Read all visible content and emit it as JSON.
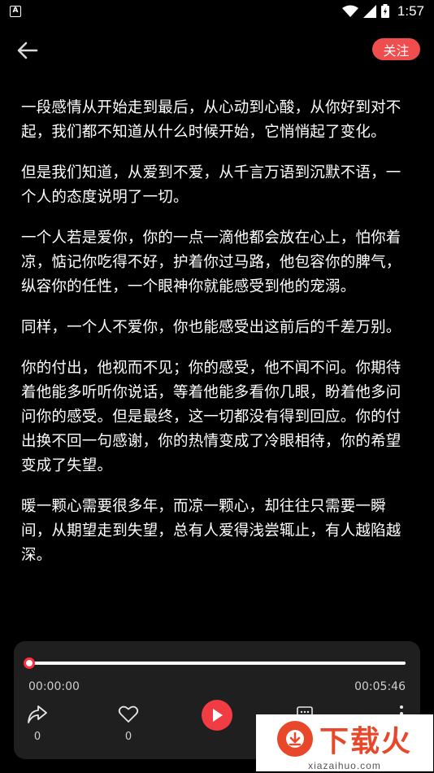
{
  "status_bar": {
    "notification_icon": "app-notification-icon",
    "time": "1:57"
  },
  "header": {
    "back_icon": "arrow-left-icon",
    "follow_label": "关注"
  },
  "article": {
    "paragraphs": [
      "一段感情从开始走到最后，从心动到心酸，从你好到对不起，我们都不知道从什么时候开始，它悄悄起了变化。",
      "但是我们知道，从爱到不爱，从千言万语到沉默不语，一个人的态度说明了一切。",
      "一个人若是爱你，你的一点一滴他都会放在心上，怕你着凉，惦记你吃得不好，护着你过马路，他包容你的脾气，纵容你的任性，一个眼神你就能感受到他的宠溺。",
      "同样，一个人不爱你，你也能感受出这前后的千差万别。",
      "你的付出，他视而不见；你的感受，他不闻不问。你期待着他能多听听你说话，等着他能多看你几眼，盼着他多问问你的感受。但是最终，这一切都没有得到回应。你的付出换不回一句感谢，你的热情变成了冷眼相待，你的希望变成了失望。",
      "暖一颗心需要很多年，而凉一颗心，却往往只需要一瞬间，从期望走到失望，总有人爱得浅尝辄止，有人越陷越深。"
    ]
  },
  "player": {
    "progress": 0.0,
    "time_current": "00:00:00",
    "time_total": "00:05:46",
    "share_count": "0",
    "like_count": "0",
    "accent_color": "#f23c44"
  },
  "watermark": {
    "title": "下载火",
    "url": "xiazaihuo.com"
  }
}
